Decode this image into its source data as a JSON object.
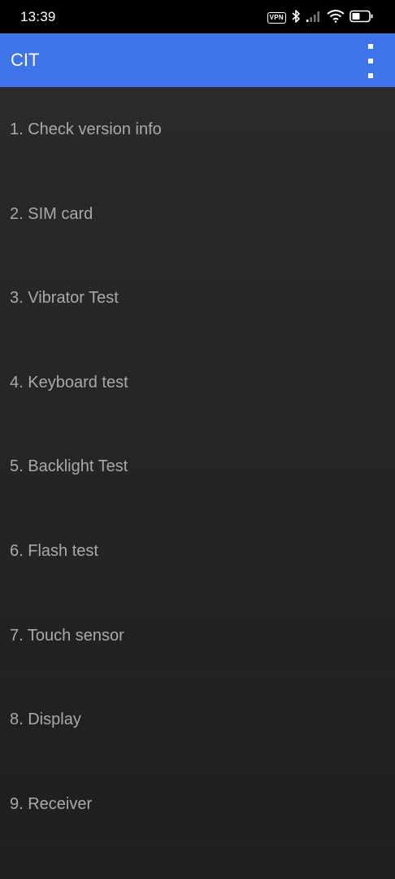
{
  "status_bar": {
    "time": "13:39",
    "vpn_label": "VPN",
    "icons": [
      "vpn-icon",
      "bluetooth-icon",
      "cellular-signal-icon",
      "wifi-icon",
      "battery-icon"
    ]
  },
  "app_bar": {
    "title": "CIT",
    "menu_icon": "more-vert-icon",
    "background": "#3f73ea"
  },
  "list": {
    "items": [
      {
        "label": "1. Check version info"
      },
      {
        "label": "2. SIM card"
      },
      {
        "label": "3. Vibrator Test"
      },
      {
        "label": "4. Keyboard test"
      },
      {
        "label": "5. Backlight Test"
      },
      {
        "label": "6. Flash test"
      },
      {
        "label": "7. Touch sensor"
      },
      {
        "label": "8. Display"
      },
      {
        "label": "9. Receiver"
      }
    ]
  }
}
